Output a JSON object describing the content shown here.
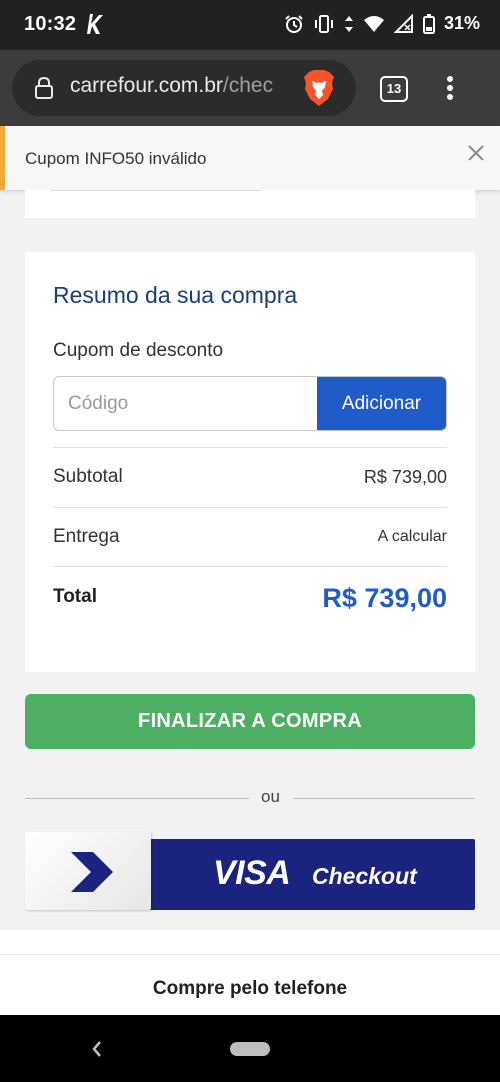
{
  "status_bar": {
    "time": "10:32",
    "battery": "31%",
    "icons": [
      "k-notification-icon",
      "alarm-icon",
      "vibrate-icon",
      "data-arrows-icon",
      "wifi-icon",
      "signal-icon",
      "battery-icon"
    ]
  },
  "browser": {
    "url_host": "carrefour.com.br",
    "url_path": "/chec",
    "tab_count": "13"
  },
  "toast": {
    "message": "Cupom INFO50 inválido",
    "accent_color": "#f2a93b"
  },
  "summary": {
    "title": "Resumo da sua compra",
    "coupon_label": "Cupom de desconto",
    "coupon_placeholder": "Código",
    "coupon_button": "Adicionar",
    "subtotal_label": "Subtotal",
    "subtotal_value": "R$ 739,00",
    "delivery_label": "Entrega",
    "delivery_value": "A calcular",
    "total_label": "Total",
    "total_value": "R$ 739,00"
  },
  "actions": {
    "finalize_label": "FINALIZAR A COMPRA",
    "or_label": "ou",
    "visa_brand": "VISA",
    "visa_checkout": "Checkout"
  },
  "footer": {
    "phone_label": "Compre pelo telefone"
  },
  "colors": {
    "primary_blue": "#1f5cc9",
    "title_blue": "#1a3e78",
    "finalize_green": "#4caf63",
    "visa_navy": "#1a237e"
  }
}
